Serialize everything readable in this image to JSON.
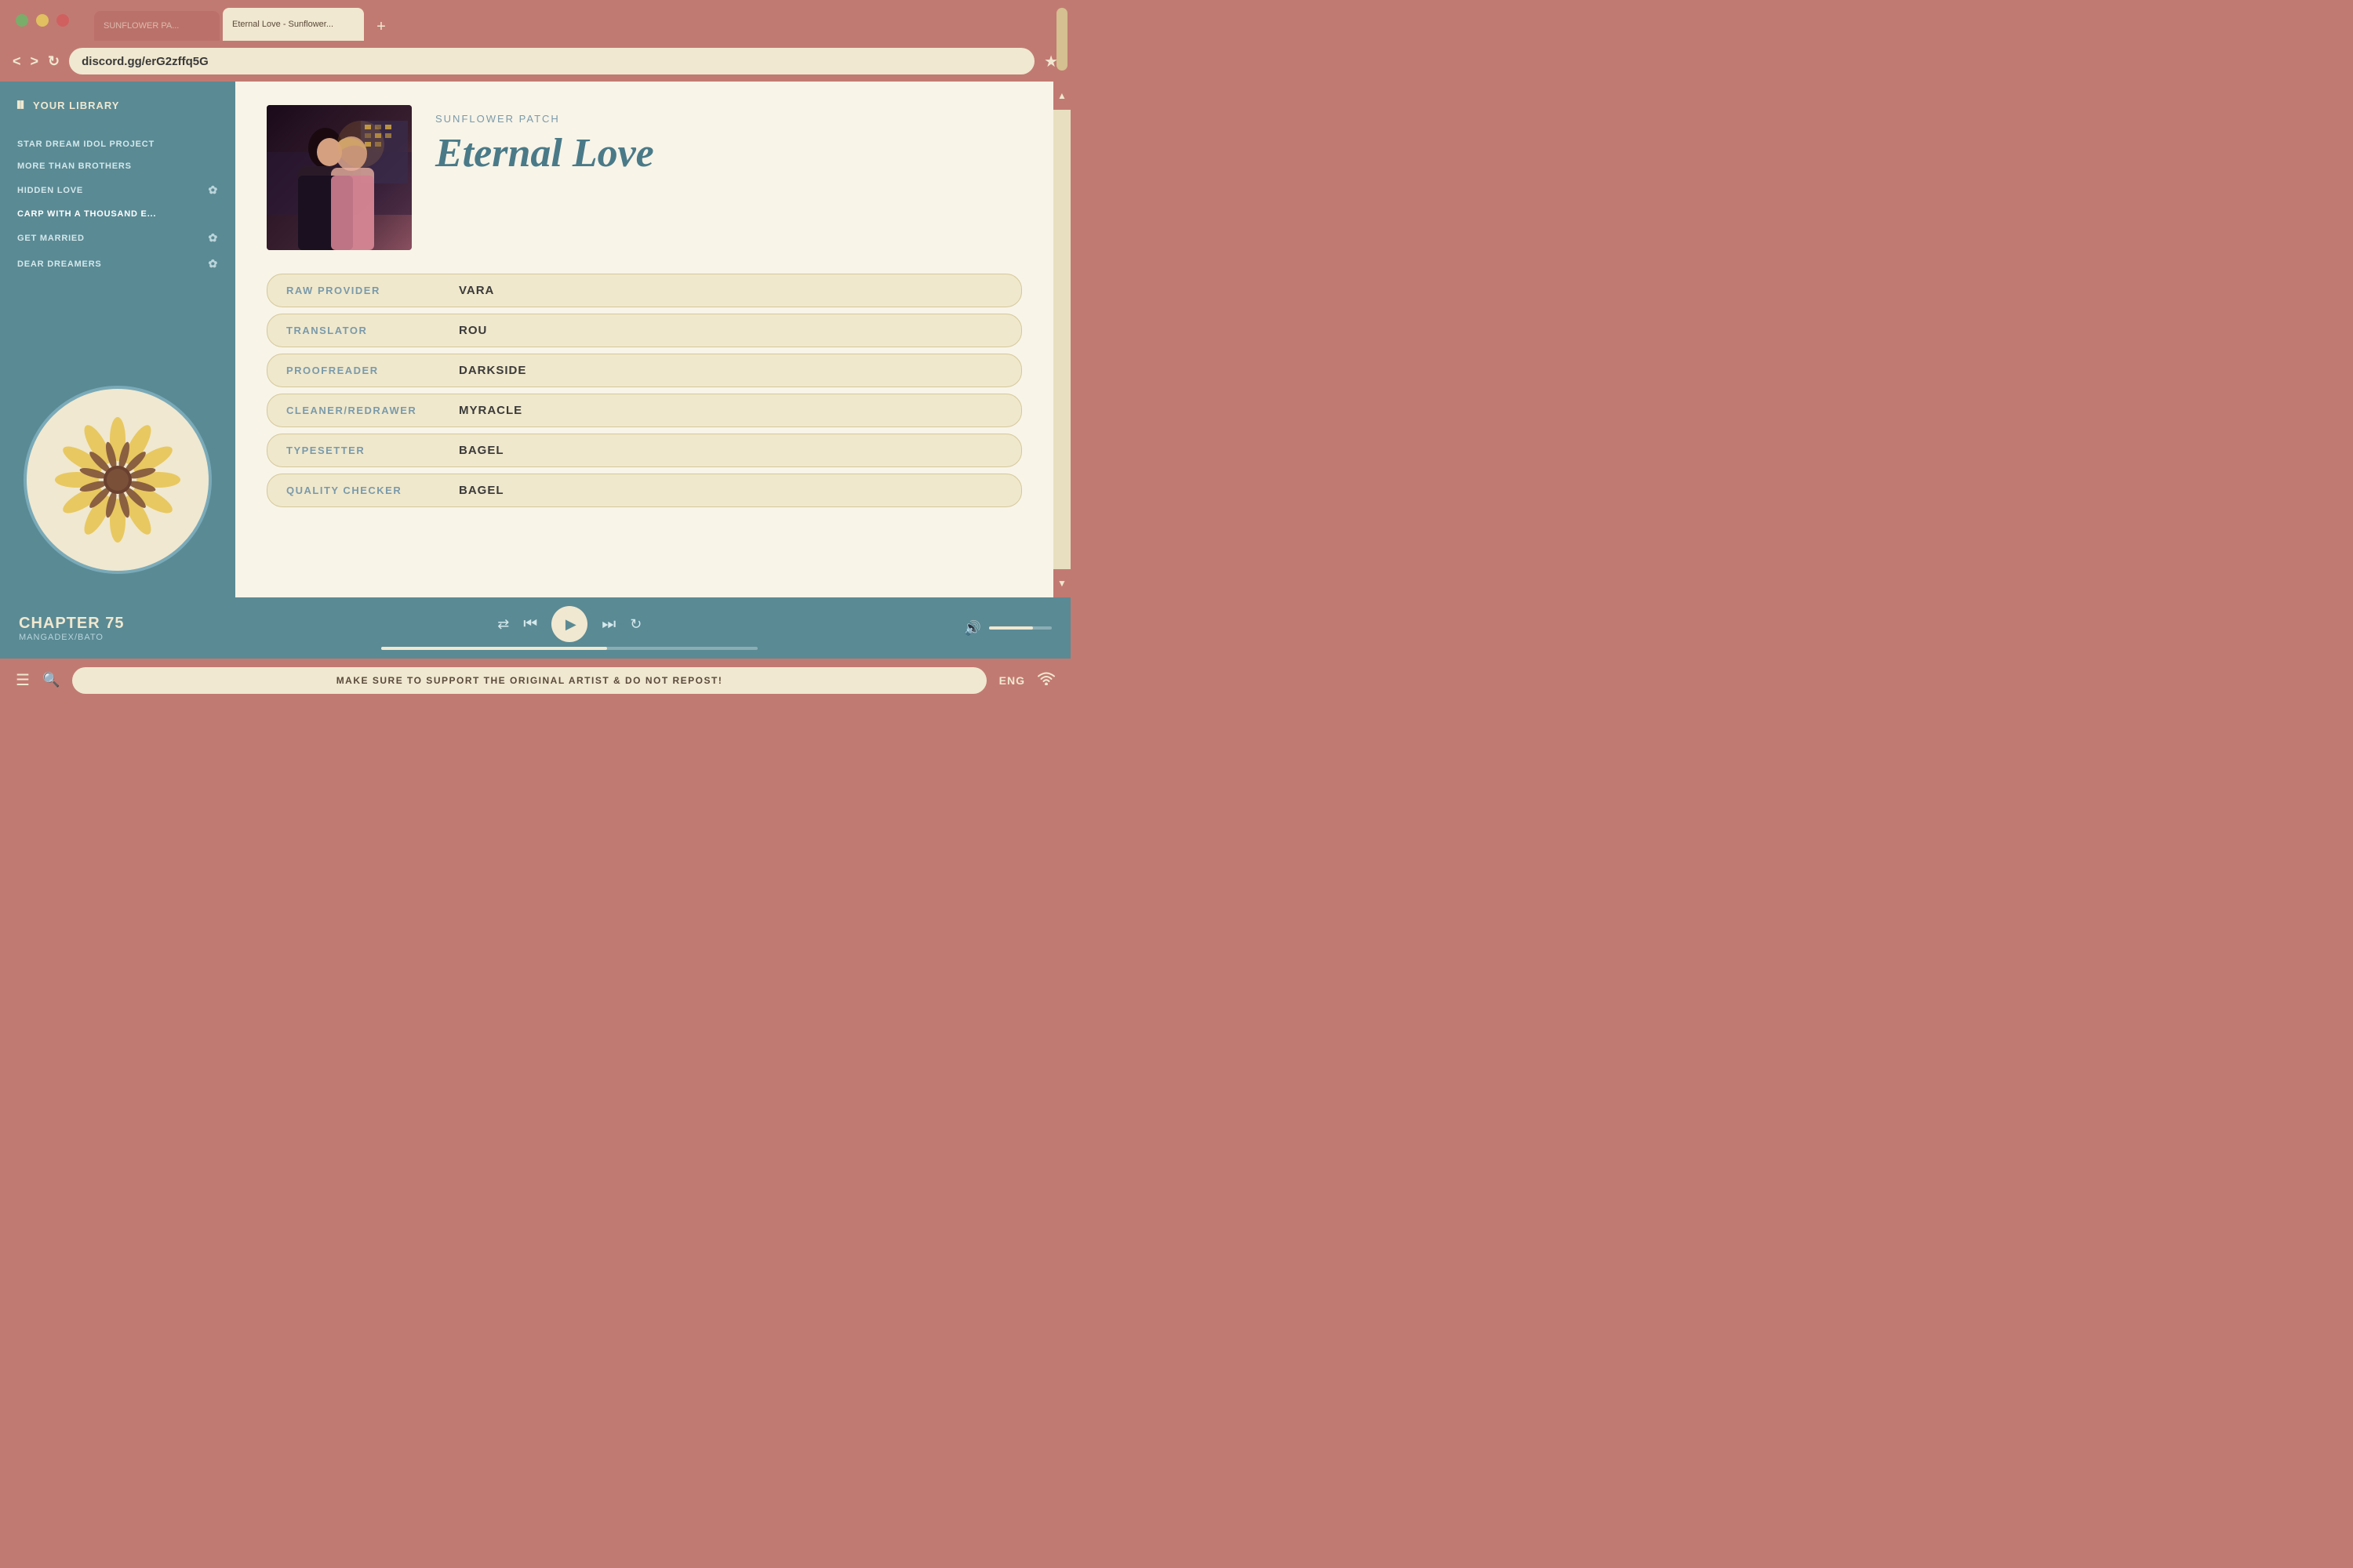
{
  "browser": {
    "tab_inactive": "SUNFLOWER PA...",
    "tab_active_label": "Eternal Love - Sunflower...",
    "tab_new": "+",
    "win_btn_green": "green",
    "win_btn_yellow": "yellow",
    "win_btn_red": "red",
    "address_bar": "discord.gg/erG2zffq5G",
    "star_icon": "★"
  },
  "sidebar": {
    "title": "YOUR LIBRARY",
    "library_icon": "|||",
    "items": [
      {
        "label": "STAR DREAM IDOL PROJECT",
        "has_icon": false
      },
      {
        "label": "MORE THAN BROTHERS",
        "has_icon": false
      },
      {
        "label": "HIDDEN LOVE",
        "has_icon": true
      },
      {
        "label": "CARP WITH A THOUSAND E...",
        "has_icon": false,
        "active": true
      },
      {
        "label": "GET MARRIED",
        "has_icon": true
      },
      {
        "label": "DEAR DREAMERS",
        "has_icon": true
      }
    ]
  },
  "manga": {
    "group_name": "SUNFLOWER PATCH",
    "title": "Eternal Love",
    "credits": [
      {
        "label": "RAW PROVIDER",
        "value": "VARA"
      },
      {
        "label": "TRANSLATOR",
        "value": "ROU"
      },
      {
        "label": "PROOFREADER",
        "value": "DARKSIDE"
      },
      {
        "label": "CLEANER/REDRAWER",
        "value": "MYRACLE"
      },
      {
        "label": "TYPESETTER",
        "value": "BAGEL"
      },
      {
        "label": "QUALITY CHECKER",
        "value": "BAGEL"
      }
    ]
  },
  "player": {
    "chapter_title": "CHAPTER 75",
    "chapter_source": "MANGADEX/BATO",
    "shuffle_icon": "⇄",
    "prev_icon": "⏮",
    "play_icon": "▶",
    "next_icon": "⏭",
    "repeat_icon": "↻",
    "volume_icon": "🔊"
  },
  "status_bar": {
    "message": "MAKE SURE TO SUPPORT THE ORIGINAL ARTIST & DO NOT REPOST!",
    "language": "ENG",
    "menu_icon": "☰",
    "search_icon": "🔍",
    "wifi_icon": "wifi"
  }
}
